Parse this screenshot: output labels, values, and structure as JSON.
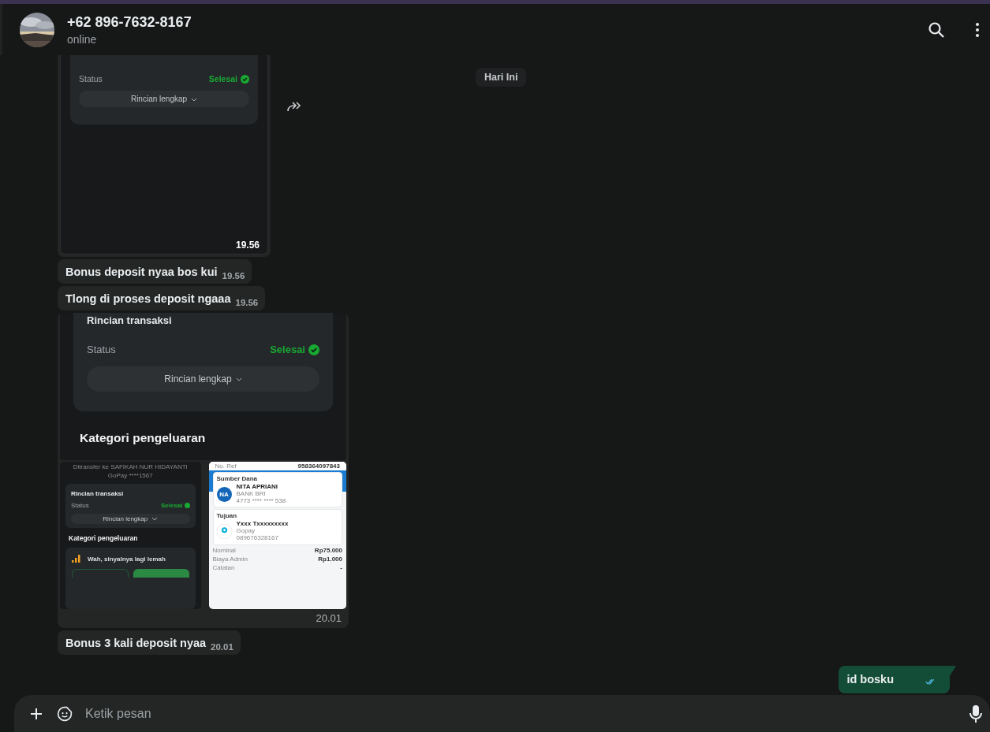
{
  "header": {
    "name": "+62 896-7632-8167",
    "status": "online"
  },
  "date_chip": "Hari Ini",
  "messages": [
    {
      "outgoing": false,
      "show_forward": true,
      "time": "19.56",
      "screen": {
        "status_label": "Status",
        "status_value": "Selesai",
        "details_button": "Rincian lengkap"
      }
    },
    {
      "kind": "text",
      "outgoing": false,
      "text": "Bonus deposit nyaa bos kui",
      "time": "19.56"
    },
    {
      "kind": "text",
      "outgoing": false,
      "text": "Tlong di proses deposit ngaaa",
      "time": "19.56"
    },
    {
      "kind": "album",
      "outgoing": false,
      "time": "20.01",
      "wide": {
        "title": "Rincian transaksi",
        "status_label": "Status",
        "status_value": "Selesai",
        "details_button": "Rincian lengkap",
        "section_title": "Kategori pengeluaran"
      },
      "left": {
        "lines": [
          "Ditransfer ke SAFIKAH NUR HIDAYANTI",
          "GoPay ****1567"
        ],
        "title": "Rincian transaksi",
        "status_label": "Status",
        "status_value": "Selesai",
        "details_button": "Rincian lengkap",
        "section_title": "Kategori pengeluaran",
        "alert": "Wah, sinyalnya lagi lemah"
      },
      "right": {
        "ref_label": "No. Ref",
        "ref_value": "958364097843",
        "source_title": "Sumber Dana",
        "source_initials": "NA",
        "source_name": "NITA APRIANI",
        "source_bank": "BANK BRI",
        "source_account": "4773 **** **** 538",
        "dest_title": "Tujuan",
        "dest_name": "Yxxx Txxxxxxxxx",
        "dest_wallet": "Gopay",
        "dest_number": "089676328167",
        "rows": [
          {
            "label": "Nominal",
            "value": "Rp75.000"
          },
          {
            "label": "Biaya Admin",
            "value": "Rp1.000"
          },
          {
            "label": "Catatan",
            "value": "-"
          }
        ]
      }
    },
    {
      "kind": "text",
      "outgoing": false,
      "text": "Bonus 3 kali deposit nyaa",
      "time": "20.01"
    },
    {
      "kind": "text",
      "outgoing": true,
      "text": "id bosku",
      "read": true
    }
  ],
  "composer": {
    "placeholder": "Ketik pesan"
  }
}
